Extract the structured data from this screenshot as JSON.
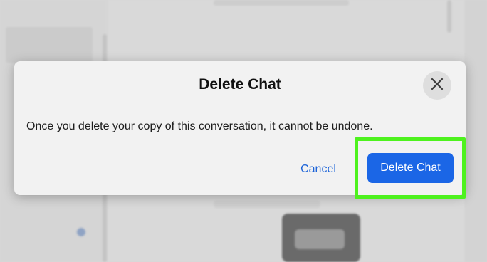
{
  "dialog": {
    "title": "Delete Chat",
    "message": "Once you delete your copy of this conversation, it cannot be undone.",
    "cancel_label": "Cancel",
    "delete_label": "Delete Chat",
    "close_icon": "close-icon"
  },
  "colors": {
    "primary_button": "#1b66e6",
    "cancel_text": "#1c63d8",
    "highlight": "#4ef21e"
  }
}
